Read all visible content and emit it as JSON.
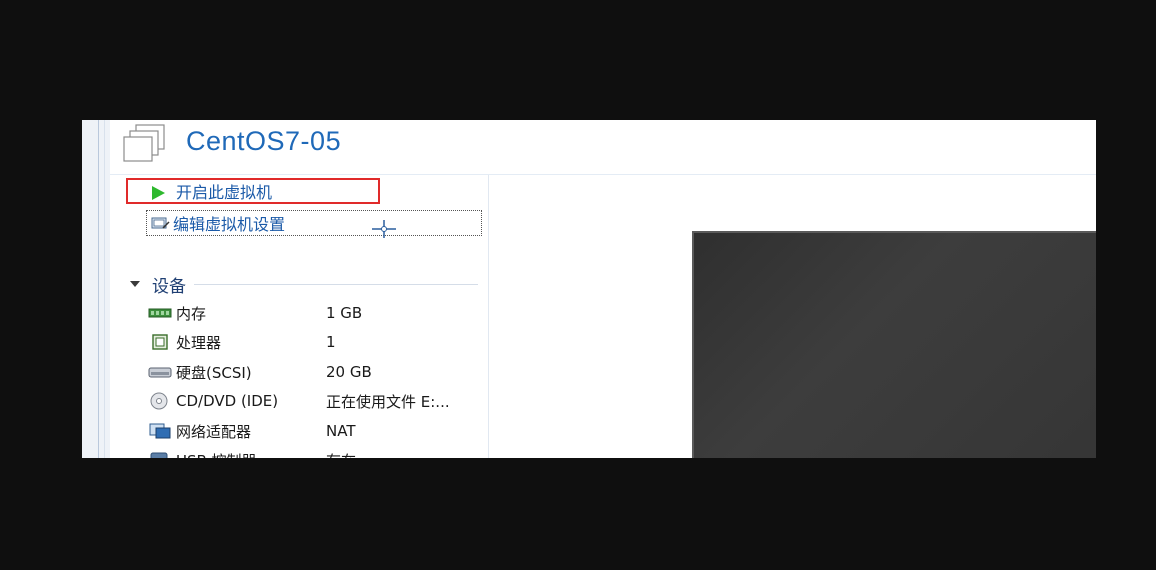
{
  "vm": {
    "title": "CentOS7-05",
    "actions": {
      "start_label": "开启此虚拟机",
      "edit_label": "编辑虚拟机设置"
    }
  },
  "devices": {
    "section_label": "设备",
    "items": [
      {
        "name": "内存",
        "value": "1 GB",
        "icon": "memory-icon"
      },
      {
        "name": "处理器",
        "value": "1",
        "icon": "processor-icon"
      },
      {
        "name": "硬盘(SCSI)",
        "value": "20 GB",
        "icon": "hard-disk-icon"
      },
      {
        "name": "CD/DVD (IDE)",
        "value": "正在使用文件 E:...",
        "icon": "cd-dvd-icon"
      },
      {
        "name": "网络适配器",
        "value": "NAT",
        "icon": "network-adapter-icon"
      },
      {
        "name": "USB 控制器",
        "value": "存在",
        "icon": "usb-controller-icon"
      }
    ]
  },
  "colors": {
    "highlight_border": "#e02a2a",
    "title_blue": "#1f69b8",
    "play_green": "#2eb82e"
  }
}
